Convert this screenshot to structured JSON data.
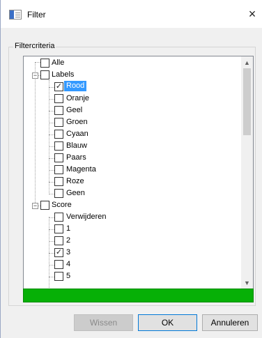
{
  "window": {
    "title": "Filter",
    "close_glyph": "×"
  },
  "group": {
    "label": "Filtercriteria"
  },
  "tree": {
    "root": {
      "label": "Alle",
      "checked": false
    },
    "labels": {
      "label": "Labels",
      "expander": "−",
      "checked": false,
      "children": [
        {
          "label": "Rood",
          "checked": true,
          "selected": true
        },
        {
          "label": "Oranje",
          "checked": false
        },
        {
          "label": "Geel",
          "checked": false
        },
        {
          "label": "Groen",
          "checked": false
        },
        {
          "label": "Cyaan",
          "checked": false
        },
        {
          "label": "Blauw",
          "checked": false
        },
        {
          "label": "Paars",
          "checked": false
        },
        {
          "label": "Magenta",
          "checked": false
        },
        {
          "label": "Roze",
          "checked": false
        },
        {
          "label": "Geen",
          "checked": false
        }
      ]
    },
    "score": {
      "label": "Score",
      "expander": "−",
      "checked": false,
      "children": [
        {
          "label": "Verwijderen",
          "checked": false
        },
        {
          "label": "1",
          "checked": false
        },
        {
          "label": "2",
          "checked": false
        },
        {
          "label": "3",
          "checked": true
        },
        {
          "label": "4",
          "checked": false
        },
        {
          "label": "5",
          "checked": false
        }
      ]
    },
    "check_glyph": "✓",
    "scroll_up_glyph": "▲",
    "scroll_down_glyph": "▼"
  },
  "status_bar_color": "#06b006",
  "buttons": {
    "clear": "Wissen",
    "ok": "OK",
    "cancel": "Annuleren"
  }
}
